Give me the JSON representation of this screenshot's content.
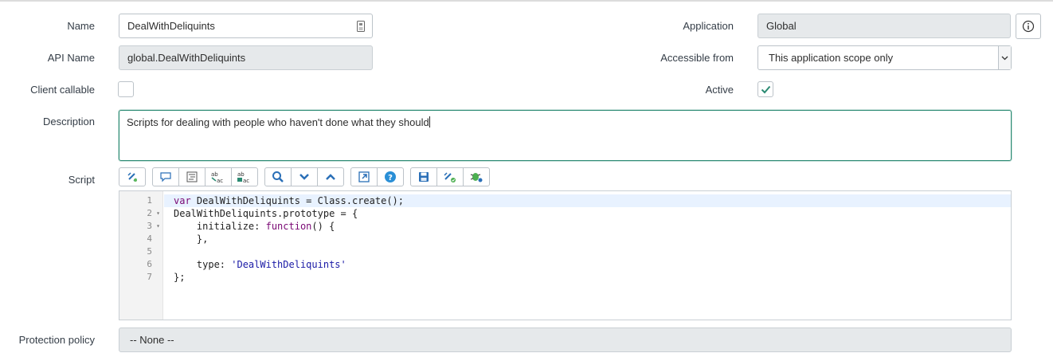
{
  "form": {
    "name": {
      "label": "Name",
      "value": "DealWithDeliquints"
    },
    "api_name": {
      "label": "API Name",
      "value": "global.DealWithDeliquints"
    },
    "client_callable": {
      "label": "Client callable",
      "checked": false
    },
    "description": {
      "label": "Description",
      "value": "Scripts for dealing with people who haven't done what they should"
    },
    "script": {
      "label": "Script"
    },
    "protection_policy": {
      "label": "Protection policy",
      "value": "-- None --"
    },
    "application": {
      "label": "Application",
      "value": "Global"
    },
    "accessible_from": {
      "label": "Accessible from",
      "value": "This application scope only"
    },
    "active": {
      "label": "Active",
      "checked": true
    }
  },
  "editor": {
    "line_numbers": [
      "1",
      "2",
      "3",
      "4",
      "5",
      "6",
      "7"
    ],
    "lines": [
      "var DealWithDeliquints = Class.create();",
      "DealWithDeliquints.prototype = {",
      "    initialize: function() {",
      "    },",
      "",
      "    type: 'DealWithDeliquints'",
      "};"
    ]
  },
  "toolbar_icons": [
    "toggle-syntax-icon",
    "comment-icon",
    "format-code-icon",
    "replace-icon",
    "replace-all-icon",
    "search-icon",
    "find-next-icon",
    "find-previous-icon",
    "fullscreen-icon",
    "help-icon",
    "save-icon",
    "script-debugger-icon",
    "debug-icon"
  ],
  "colors": {
    "accent_green": "#2a8a72",
    "readonly_bg": "#e6e9eb",
    "toolbar_blue": "#2a6fb7"
  }
}
